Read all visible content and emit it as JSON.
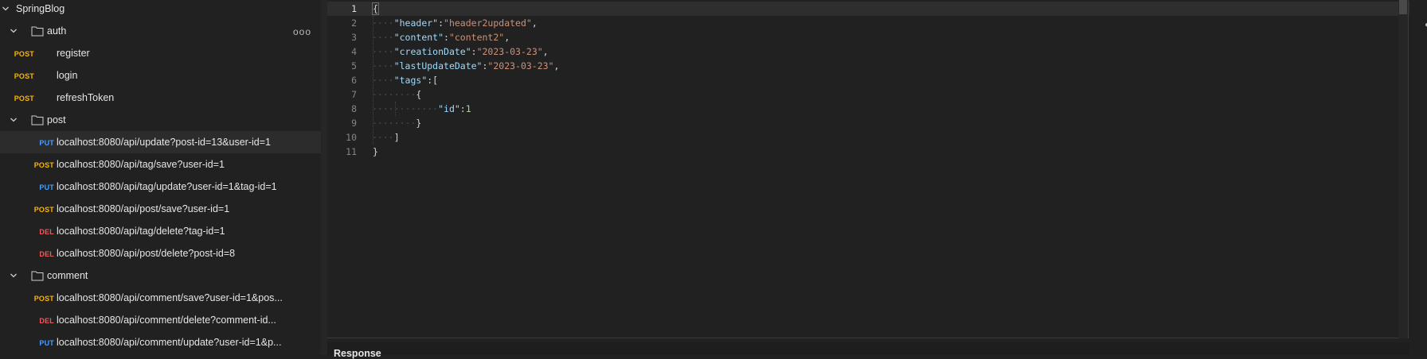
{
  "collection": {
    "name": "SpringBlog",
    "folders": [
      {
        "name": "auth",
        "more": "ooo"
      },
      {
        "name": "post"
      },
      {
        "name": "comment"
      }
    ]
  },
  "requests": [
    {
      "method": "POST",
      "label": "register"
    },
    {
      "method": "POST",
      "label": "login"
    },
    {
      "method": "POST",
      "label": "refreshToken"
    },
    {
      "method": "PUT",
      "label": "localhost:8080/api/update?post-id=13&user-id=1"
    },
    {
      "method": "POST",
      "label": "localhost:8080/api/tag/save?user-id=1"
    },
    {
      "method": "PUT",
      "label": "localhost:8080/api/tag/update?user-id=1&tag-id=1"
    },
    {
      "method": "POST",
      "label": "localhost:8080/api/post/save?user-id=1"
    },
    {
      "method": "DEL",
      "label": "localhost:8080/api/tag/delete?tag-id=1"
    },
    {
      "method": "DEL",
      "label": "localhost:8080/api/post/delete?post-id=8"
    },
    {
      "method": "POST",
      "label": "localhost:8080/api/comment/save?user-id=1&pos..."
    },
    {
      "method": "DEL",
      "label": "localhost:8080/api/comment/delete?comment-id..."
    },
    {
      "method": "PUT",
      "label": "localhost:8080/api/comment/update?user-id=1&p..."
    }
  ],
  "editor": {
    "line_numbers": [
      "1",
      "2",
      "3",
      "4",
      "5",
      "6",
      "7",
      "8",
      "9",
      "10",
      "11"
    ],
    "body": {
      "header_key": "\"header\"",
      "header_val": "\"header2updated\"",
      "content_key": "\"content\"",
      "content_val": "\"content2\"",
      "creation_key": "\"creationDate\"",
      "creation_val": "\"2023-03-23\"",
      "lastupdate_key": "\"lastUpdateDate\"",
      "lastupdate_val": "\"2023-03-23\"",
      "tags_key": "\"tags\"",
      "id_key": "\"id\"",
      "id_val": "1"
    }
  },
  "response": {
    "title": "Response"
  },
  "colors": {
    "post": "#ffb400",
    "put": "#4a9eff",
    "del": "#f05a5a",
    "background": "#212121"
  }
}
